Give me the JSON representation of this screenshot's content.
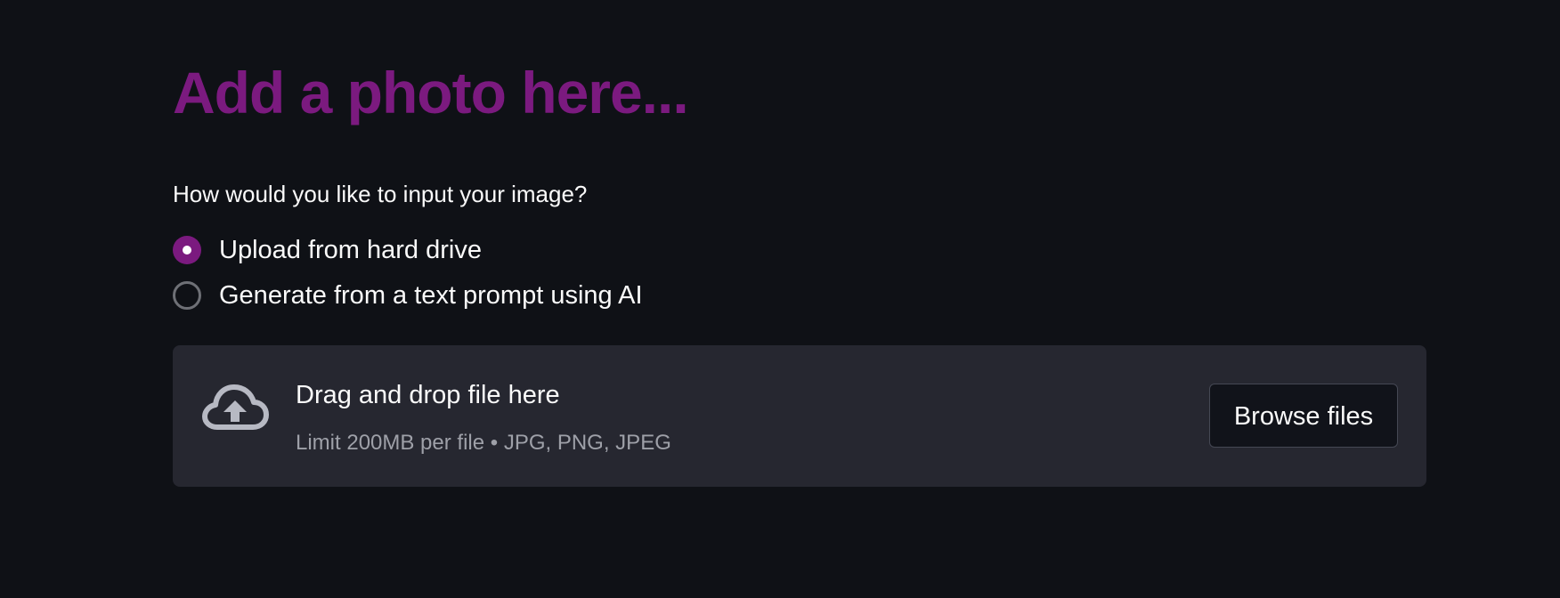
{
  "page": {
    "title": "Add a photo here...",
    "question": "How would you like to input your image?",
    "input_options": [
      {
        "label": "Upload from hard drive",
        "selected": true
      },
      {
        "label": "Generate from a text prompt using AI",
        "selected": false
      }
    ],
    "uploader": {
      "icon": "cloud-upload-icon",
      "drag_text": "Drag and drop file here",
      "limit_text": "Limit 200MB per file • JPG, PNG, JPEG",
      "browse_label": "Browse files"
    }
  },
  "colors": {
    "background": "#0f1116",
    "accent": "#7b1a7f",
    "uploader_background": "#262730",
    "muted_text": "#9ea0a8",
    "button_border": "#454854"
  }
}
